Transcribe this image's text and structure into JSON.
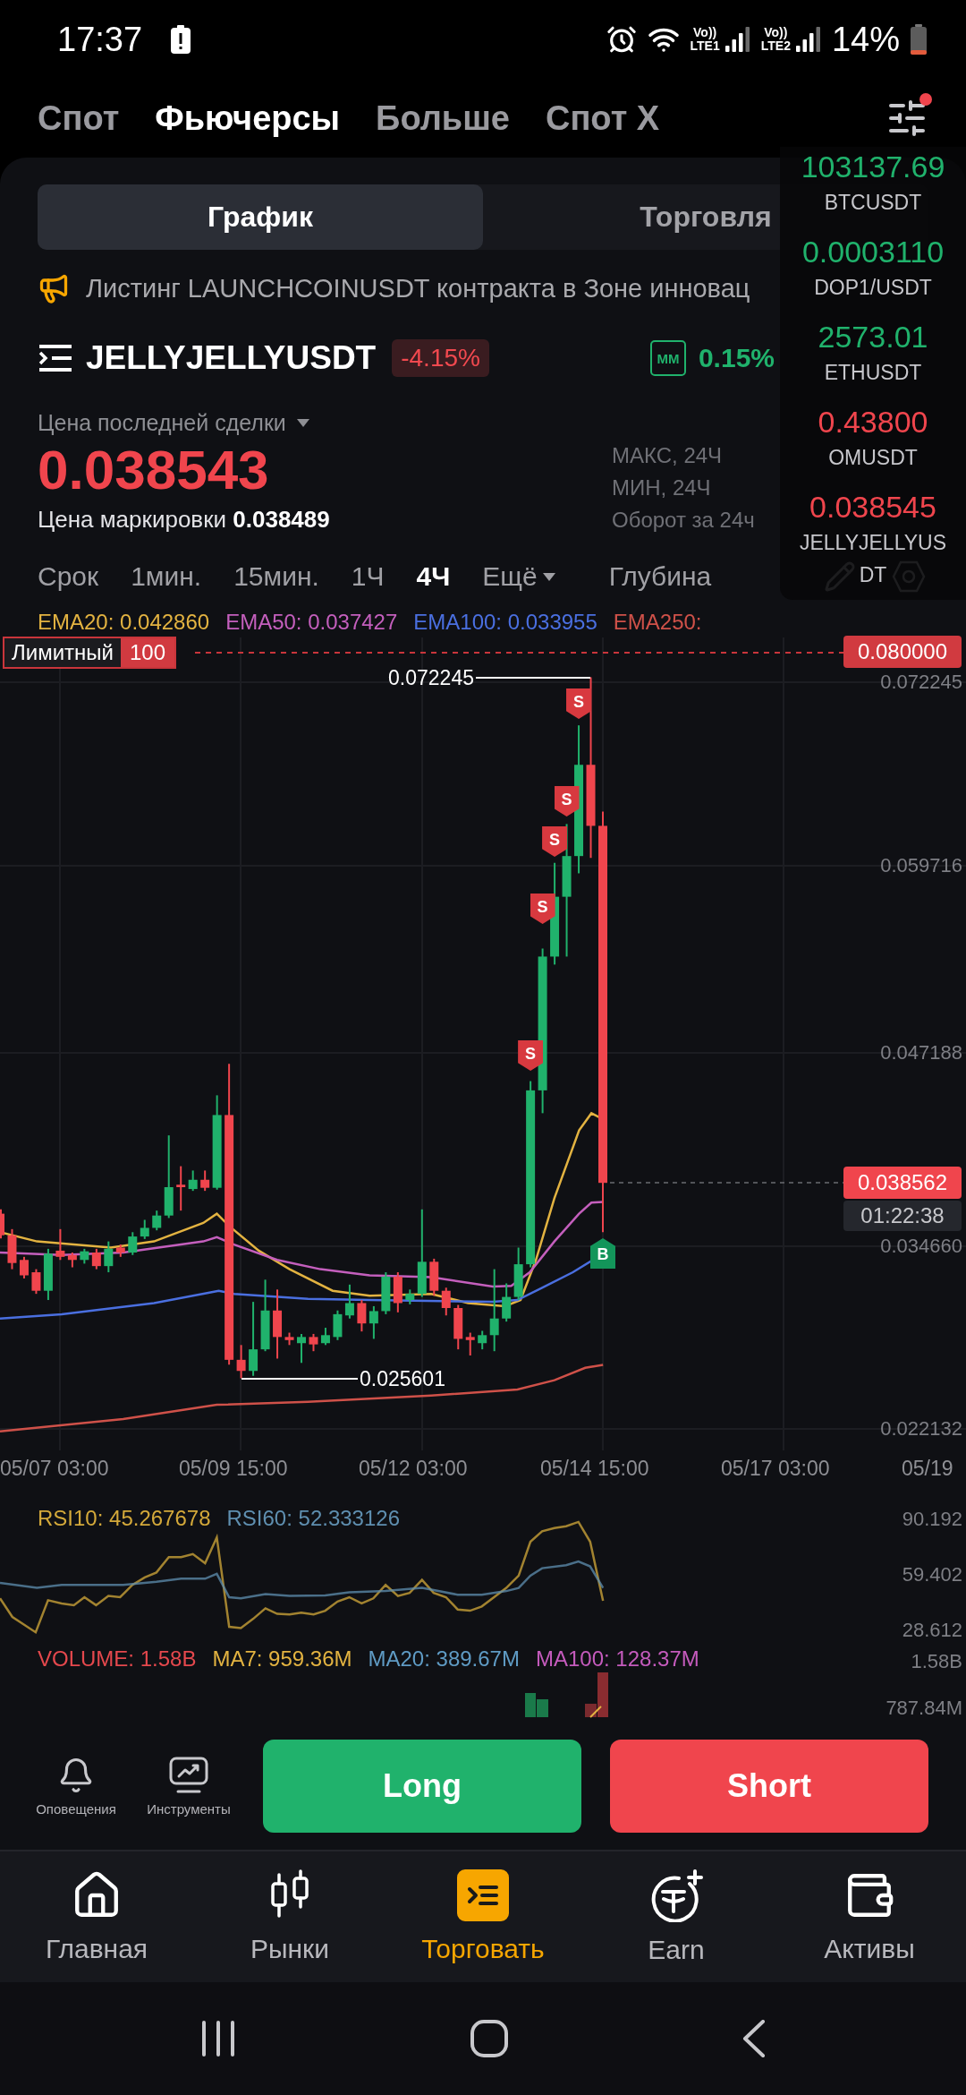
{
  "status_bar": {
    "time": "17:37",
    "networks": [
      {
        "voice": "Vo))",
        "type": "LTE1"
      },
      {
        "voice": "Vo))",
        "type": "LTE2"
      }
    ],
    "battery": "14%"
  },
  "top_tabs": [
    {
      "label": "Спот",
      "selected": false
    },
    {
      "label": "Фьючерсы",
      "selected": true
    },
    {
      "label": "Больше",
      "selected": false
    },
    {
      "label": "Спот X",
      "selected": false
    }
  ],
  "filter_button": {
    "notification": true
  },
  "ticker_overlay": [
    {
      "price": "103137.69",
      "symbol": "BTCUSDT",
      "rising": true
    },
    {
      "price": "0.0003110",
      "symbol": "DOP1/USDT",
      "rising": true
    },
    {
      "price": "2573.01",
      "symbol": "ETHUSDT",
      "rising": true
    },
    {
      "price": "0.43800",
      "symbol": "OMUSDT",
      "rising": false
    },
    {
      "price": "0.038545",
      "symbol": "JELLYJELLYUSDT",
      "rising": false
    }
  ],
  "view_tabs": [
    {
      "label": "График",
      "selected": true
    },
    {
      "label": "Торговля",
      "selected": false
    }
  ],
  "announcement": "Листинг LAUNCHCOINUSDT контракта в Зоне инновац",
  "symbol": {
    "name": "JELLYJELLYUSDT",
    "change": "-4.15%",
    "mm_tag": "MM",
    "mm_rate": "0.15%"
  },
  "last_price": {
    "label": "Цена последней сделки",
    "value": "0.038543",
    "mark_price": "Цена маркировки **0.038489**"
  },
  "stats_labels": [
    "МАКС, 24Ч",
    "МИН, 24Ч",
    "Оборот за 24ч"
  ],
  "timeframes": [
    {
      "label": "Срок",
      "selected": false,
      "dropdown": false
    },
    {
      "label": "1мин.",
      "selected": false,
      "dropdown": false
    },
    {
      "label": "15мин.",
      "selected": false,
      "dropdown": false
    },
    {
      "label": "1Ч",
      "selected": false,
      "dropdown": false
    },
    {
      "label": "4Ч",
      "selected": true,
      "dropdown": false
    },
    {
      "label": "Ещё",
      "selected": false,
      "dropdown": true
    }
  ],
  "depth_tab": {
    "label": "Глубина",
    "selected": false
  },
  "chart": {
    "indicators": [
      {
        "label": "EMA20: 0.042860",
        "color": "#e3b341"
      },
      {
        "label": "EMA50: 0.037427",
        "color": "#c45fbd"
      },
      {
        "label": "EMA100: 0.033955",
        "color": "#4a6fe0"
      },
      {
        "label": "EMA250:",
        "color": "#cf5149"
      }
    ],
    "order": {
      "type": "Лимитный",
      "quantity": "100",
      "price": "0.080000"
    },
    "price_axis": [
      "0.072245",
      "0.059716",
      "0.047188",
      "0.034660",
      "0.022132"
    ],
    "high_label": "0.072245",
    "low_label": "0.025601",
    "last_price_tag": "0.038562",
    "countdown": "01:22:38",
    "trade_markers": [
      {
        "kind": "sell",
        "label": "S"
      },
      {
        "kind": "sell",
        "label": "S"
      },
      {
        "kind": "sell",
        "label": "S"
      },
      {
        "kind": "sell",
        "label": "S"
      },
      {
        "kind": "sell",
        "label": "S"
      },
      {
        "kind": "buy",
        "label": "B"
      }
    ],
    "time_axis": [
      "05/07 03:00",
      "05/09 15:00",
      "05/12 03:00",
      "05/14 15:00",
      "05/17 03:00",
      "05/19"
    ]
  },
  "rsi": {
    "legend": [
      {
        "label": "RSI10: 45.267678",
        "color": "#d4a93a"
      },
      {
        "label": "RSI60: 52.333126",
        "color": "#5f8fb0"
      }
    ],
    "axis": [
      "90.192",
      "59.402",
      "28.612"
    ]
  },
  "volume": {
    "legend": [
      {
        "label": "VOLUME: 1.58B",
        "color": "#e5484d"
      },
      {
        "label": "MA7: 959.36M",
        "color": "#e3b341"
      },
      {
        "label": "MA20: 389.67M",
        "color": "#5f9bc4"
      },
      {
        "label": "MA100: 128.37M",
        "color": "#c55bbd"
      }
    ],
    "axis": [
      "1.58B",
      "787.84M"
    ]
  },
  "tools": [
    {
      "label": "Оповещения",
      "kind": "bell"
    },
    {
      "label": "Инструменты",
      "kind": "monitor"
    }
  ],
  "trade_buttons": [
    {
      "label": "Long",
      "kind": "long"
    },
    {
      "label": "Short",
      "kind": "short"
    }
  ],
  "bottom_nav": [
    {
      "label": "Главная",
      "kind": "home",
      "selected": false
    },
    {
      "label": "Рынки",
      "kind": "markets",
      "selected": false
    },
    {
      "label": "Торговать",
      "kind": "trade",
      "selected": true
    },
    {
      "label": "Earn",
      "kind": "earn",
      "selected": false
    },
    {
      "label": "Активы",
      "kind": "assets",
      "selected": false
    }
  ]
}
